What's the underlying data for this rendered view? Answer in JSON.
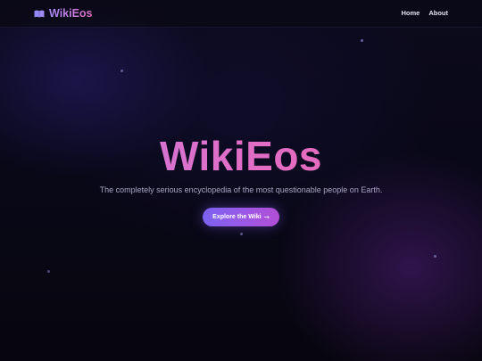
{
  "navbar": {
    "brand": {
      "icon": "book-icon",
      "name": "WikiEos"
    },
    "links": [
      {
        "label": "Home"
      },
      {
        "label": "About"
      }
    ]
  },
  "hero": {
    "title": "WikiEos",
    "subtitle": "The completely serious encyclopedia of the most questionable people on Earth.",
    "cta": {
      "label": "Explore the Wiki",
      "icon": "arrow-right-icon",
      "arrow_glyph": "→"
    }
  },
  "colors": {
    "background": "#07060f",
    "accent_gradient_start": "#c67ee6",
    "accent_gradient_end": "#ee6ab0",
    "button_gradient_start": "#7b63f0",
    "button_gradient_end": "#b24fd6",
    "nav_text": "#e4e2f0",
    "subtitle_text": "#a8a6c4"
  }
}
